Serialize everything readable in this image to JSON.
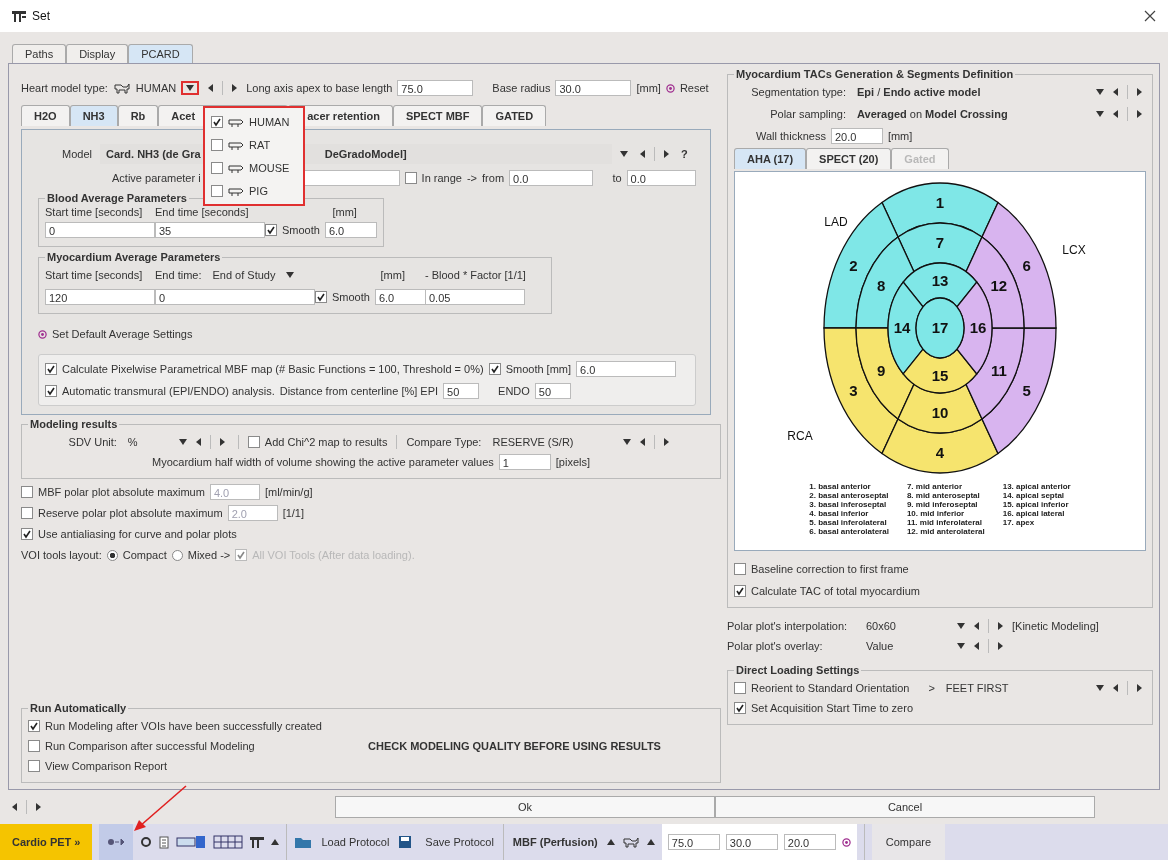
{
  "window": {
    "title": "Set"
  },
  "tabs": [
    {
      "label": "Paths",
      "selected": false
    },
    {
      "label": "Display",
      "selected": false
    },
    {
      "label": "PCARD",
      "selected": true
    }
  ],
  "heart_model": {
    "label": "Heart model type:",
    "value": "HUMAN",
    "length_label": "Long axis apex to base length",
    "length": "75.0",
    "radius_label": "Base radius",
    "radius": "30.0",
    "unit": "[mm]",
    "reset": "Reset"
  },
  "species_menu": [
    {
      "label": "HUMAN",
      "checked": true
    },
    {
      "label": "RAT",
      "checked": false
    },
    {
      "label": "MOUSE",
      "checked": false
    },
    {
      "label": "PIG",
      "checked": false
    }
  ],
  "model_tabs": [
    {
      "label": "H2O",
      "selected": false
    },
    {
      "label": "NH3",
      "selected": true
    },
    {
      "label": "Rb",
      "selected": false
    },
    {
      "label": "Acet",
      "selected": false
    },
    {
      "label": "acer retention",
      "selected": false
    },
    {
      "label": "SPECT MBF",
      "selected": false
    },
    {
      "label": "GATED",
      "selected": false
    }
  ],
  "model": {
    "label": "Model",
    "value_start": "Card. NH3 (de Gra",
    "value_end": "DeGradoModel]",
    "help": "?"
  },
  "active_parameter": {
    "label": "Active parameter i",
    "in_range": {
      "label": "In range",
      "checked": false
    },
    "arrow": "->",
    "from_label": "from",
    "from": "0.0",
    "to_label": "to",
    "to": "0.0"
  },
  "blood": {
    "title": "Blood Average Parameters",
    "start_label": "Start time [seconds]",
    "end_label": "End time [seconds]",
    "unit": "[mm]",
    "start": "0",
    "end": "35",
    "smooth": {
      "label": "Smooth",
      "checked": true,
      "value": "6.0"
    }
  },
  "myocardium": {
    "title": "Myocardium Average Parameters",
    "start_label": "Start time [seconds]",
    "end_label": "End time:",
    "end_mode": "End of Study",
    "unit": "[mm]",
    "factor_label": "- Blood * Factor [1/1]",
    "start": "120",
    "end": "0",
    "smooth": {
      "label": "Smooth",
      "checked": true,
      "value": "6.0"
    },
    "factor": "0.05"
  },
  "set_default": "Set Default Average Settings",
  "pixelwise": {
    "label": "Calculate Pixelwise Parametrical MBF map (# Basic Functions = 100, Threshold = 0%)",
    "checked": true,
    "smooth_label": "Smooth [mm]",
    "smooth_checked": true,
    "smooth": "6.0"
  },
  "transmural": {
    "label": "Automatic transmural (EPI/ENDO) analysis.",
    "checked": true,
    "distance_label": "Distance from centerline [%] EPI",
    "epi": "50",
    "endo_label": "ENDO",
    "endo": "50"
  },
  "modeling_results": {
    "title": "Modeling results",
    "sdv_label": "SDV Unit:",
    "sdv": "%",
    "chi": {
      "label": "Add Chi^2 map to results",
      "checked": false
    },
    "compare_label": "Compare Type:",
    "compare": "RESERVE (S/R)",
    "halfwidth_label": "Myocardium half width of volume showing the active parameter values",
    "halfwidth": "1",
    "halfwidth_unit": "[pixels]"
  },
  "limits": [
    {
      "label": "MBF polar plot absolute maximum",
      "checked": false,
      "value": "4.0",
      "unit": "[ml/min/g]"
    },
    {
      "label": "Reserve polar plot absolute maximum",
      "checked": false,
      "value": "2.0",
      "unit": "[1/1]"
    }
  ],
  "antialiasing": {
    "label": "Use antialiasing for curve and polar plots",
    "checked": true
  },
  "voi_layout": {
    "label": "VOI tools layout:",
    "options": [
      {
        "label": "Compact",
        "selected": true
      },
      {
        "label": "Mixed ->",
        "selected": false
      }
    ],
    "all_tools": {
      "label": "All VOI Tools  (After data loading).",
      "checked": true,
      "disabled": true
    }
  },
  "run_automatically": {
    "title": "Run Automatically",
    "items": [
      {
        "label": "Run Modeling after VOIs have been successfully created",
        "checked": true
      },
      {
        "label": "Run Comparison after successful Modeling",
        "checked": false
      },
      {
        "label": "View Comparison Report",
        "checked": false
      }
    ],
    "warning": "CHECK MODELING QUALITY BEFORE USING RESULTS"
  },
  "segments_panel": {
    "title": "Myocardium TACs Generation & Segments Definition",
    "segmentation_label": "Segmentation type:",
    "segmentation": "**Epi** / **Endo active model**",
    "sampling_label": "Polar sampling:",
    "sampling": "**Averaged** on **Model Crossing**",
    "wall_label": "Wall thickness",
    "wall": "20.0",
    "wall_unit": "[mm]",
    "tabs": [
      {
        "label": "AHA (17)",
        "selected": true,
        "disabled": false
      },
      {
        "label": "SPECT (20)",
        "selected": false,
        "disabled": false
      },
      {
        "label": "Gated",
        "selected": false,
        "disabled": true
      }
    ],
    "polar_plot": {
      "rings": [
        {
          "segments": [
            {
              "number": "1",
              "color": "#7fe7e7"
            },
            {
              "number": "2",
              "color": "#7fe7e7"
            },
            {
              "number": "3",
              "color": "#f6e46e"
            },
            {
              "number": "4",
              "color": "#f6e46e"
            },
            {
              "number": "5",
              "color": "#d8b4ef"
            },
            {
              "number": "6",
              "color": "#d8b4ef"
            }
          ]
        },
        {
          "segments": [
            {
              "number": "7",
              "color": "#7fe7e7"
            },
            {
              "number": "8",
              "color": "#7fe7e7"
            },
            {
              "number": "9",
              "color": "#f6e46e"
            },
            {
              "number": "10",
              "color": "#f6e46e"
            },
            {
              "number": "11",
              "color": "#d8b4ef"
            },
            {
              "number": "12",
              "color": "#d8b4ef"
            }
          ]
        },
        {
          "segments": [
            {
              "number": "13",
              "color": "#7fe7e7"
            },
            {
              "number": "14",
              "color": "#7fe7e7"
            },
            {
              "number": "15",
              "color": "#f6e46e"
            },
            {
              "number": "16",
              "color": "#d8b4ef"
            }
          ]
        }
      ],
      "apex": {
        "number": "17",
        "color": "#7fe7e7"
      },
      "territories": [
        "LAD",
        "LCX",
        "RCA"
      ],
      "legend": [
        "1. basal anterior",
        "2. basal anteroseptal",
        "3. basal inferoseptal",
        "4. basal inferior",
        "5. basal inferolateral",
        "6. basal anterolateral",
        "7. mid anterior",
        "8. mid anteroseptal",
        "9. mid inferoseptal",
        "10. mid inferior",
        "11. mid inferolateral",
        "12. mid anterolateral",
        "13. apical anterior",
        "14. apical septal",
        "15. apical inferior",
        "16. apical lateral",
        "17. apex"
      ]
    },
    "baseline": {
      "label": "Baseline correction to first frame",
      "checked": false
    },
    "total_tac": {
      "label": "Calculate TAC of total myocardium",
      "checked": true
    }
  },
  "polar_display": [
    {
      "label": "Polar plot's interpolation:",
      "value": "60x60",
      "extra": "[Kinetic Modeling]"
    },
    {
      "label": "Polar plot's overlay:",
      "value": "Value"
    }
  ],
  "direct_loading": {
    "title": "Direct Loading Settings",
    "reorient": {
      "label": "Reorient to Standard Orientation",
      "checked": false,
      "arrow": ">",
      "value": "FEET FIRST"
    },
    "acq_zero": {
      "label": "Set Acquisition Start Time to zero",
      "checked": true
    }
  },
  "dialog_buttons": [
    "Ok",
    "Cancel"
  ],
  "toolbar": {
    "app": "Cardio PET »",
    "load": "Load Protocol",
    "save": "Save Protocol",
    "mode": "MBF (Perfusion)",
    "fields": [
      "75.0",
      "30.0",
      "20.0"
    ],
    "compare": "Compare"
  }
}
